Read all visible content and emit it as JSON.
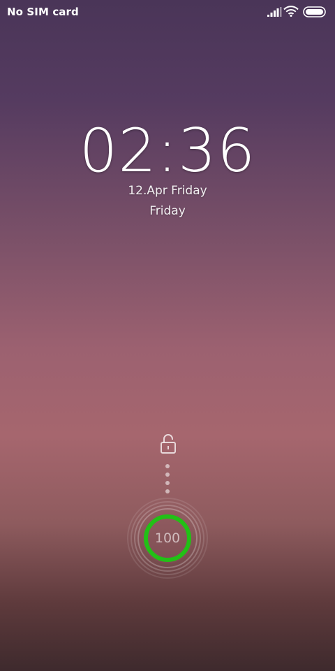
{
  "status_bar": {
    "carrier": "No SIM card",
    "icons": [
      "signal-icon",
      "wifi-icon",
      "battery-icon"
    ]
  },
  "clock": {
    "time": "02:36",
    "date": "12.Apr Friday",
    "day": "Friday"
  },
  "unlock": {
    "lock_icon": "unlock-icon",
    "battery_level": "100",
    "battery_fraction": 1.0,
    "ring_color": "#22c016"
  },
  "colors": {
    "background_top": "#4a3558",
    "background_mid": "#a6666e",
    "background_bottom": "#3e2a2d"
  }
}
